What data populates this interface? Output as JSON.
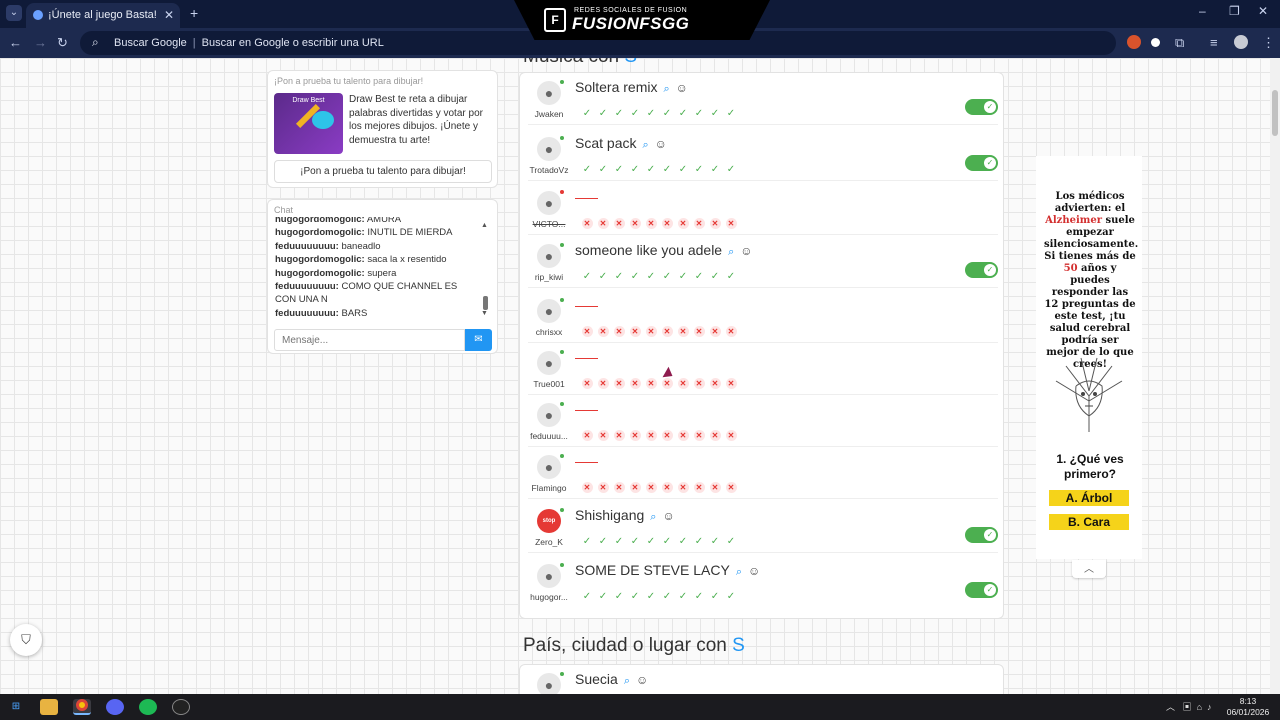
{
  "browser": {
    "tab_title": "¡Únete al juego Basta!",
    "tab_close": "✕",
    "new_tab": "+",
    "omnibox_engine": "Buscar Google",
    "omnibox_placeholder": "Buscar en Google o escribir una URL",
    "window_controls": [
      "–",
      "❐",
      "✕"
    ]
  },
  "brand": {
    "sub": "REDES SOCIALES DE FUSION",
    "main": "FUSIONFSGG"
  },
  "promo": {
    "title": "¡Pon a prueba tu talento para dibujar!",
    "image_label": "Draw Best",
    "description": "Draw Best te reta a dibujar palabras divertidas y votar por los mejores dibujos. ¡Únete y demuestra tu arte!",
    "button": "¡Pon a prueba tu talento para dibujar!"
  },
  "chat": {
    "title": "Chat",
    "messages": [
      {
        "user": "hugogordomogolic:",
        "text": " AMURA"
      },
      {
        "user": "hugogordomogolic:",
        "text": " INUTIL DE MIERDA"
      },
      {
        "user": "feduuuuuuuu:",
        "text": " baneadlo"
      },
      {
        "user": "hugogordomogolic:",
        "text": " saca la x resentido"
      },
      {
        "user": "hugogordomogolic:",
        "text": " supera"
      },
      {
        "user": "feduuuuuuuu:",
        "text": " COMO QUE CHANNEL ES CON UNA N"
      },
      {
        "user": "feduuuuuuuu:",
        "text": " BARS"
      }
    ],
    "input_placeholder": "Mensaje..."
  },
  "music_section": {
    "title_prefix": "Música con",
    "letter": "S",
    "rows": [
      {
        "user": "Jwaken",
        "answer": "Soltera remix",
        "valid": true,
        "status": "online",
        "votes": "ok"
      },
      {
        "user": "TrotadoVz",
        "answer": "Scat pack",
        "valid": true,
        "status": "online",
        "votes": "ok"
      },
      {
        "user": "VICTO...",
        "answer": "",
        "valid": false,
        "status": "away",
        "votes": "no"
      },
      {
        "user": "rip_kiwi",
        "answer": "someone like you adele",
        "valid": true,
        "status": "online",
        "votes": "ok"
      },
      {
        "user": "chrisxx",
        "answer": "",
        "valid": false,
        "status": "online",
        "votes": "no"
      },
      {
        "user": "True001",
        "answer": "",
        "valid": false,
        "status": "online",
        "votes": "no"
      },
      {
        "user": "feduuuu...",
        "answer": "",
        "valid": false,
        "status": "online",
        "votes": "no"
      },
      {
        "user": "Flamingo",
        "answer": "",
        "valid": false,
        "status": "online",
        "votes": "no"
      },
      {
        "user": "Zero_K",
        "answer": "Shishigang",
        "valid": true,
        "status": "online",
        "votes": "ok",
        "avatar": "stop"
      },
      {
        "user": "hugogor...",
        "answer": "SOME DE STEVE LACY",
        "valid": true,
        "status": "online",
        "votes": "ok"
      }
    ]
  },
  "country_section": {
    "title_prefix": "País, ciudad o lugar con",
    "letter": "S",
    "first_answer": "Suecia"
  },
  "ad": {
    "line1": "Los médicos advierten: el",
    "highlight1": "Alzheimer",
    "line2": "suele empezar silenciosamente. Si tienes más de",
    "highlight2": "50",
    "line3": "años y puedes responder las 12 preguntas de este test, ¡tu salud cerebral podría ser mejor de lo que crees!",
    "question": "1. ¿Qué ves primero?",
    "option_a": "A. Árbol",
    "option_b": "B. Cara"
  },
  "taskbar": {
    "time": "8:13",
    "date": "06/01/2026"
  },
  "colors": {
    "accent": "#2196f3",
    "valid": "#4caf50",
    "invalid": "#e53935",
    "browser_bg": "#1d2a4f"
  }
}
